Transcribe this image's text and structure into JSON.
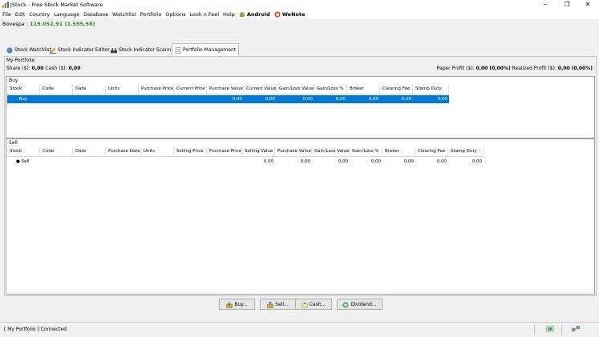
{
  "window": {
    "title": "JStock - Free Stock Market Software",
    "minimize": "–",
    "maximize": "❐",
    "close": "✕"
  },
  "menu": {
    "items": [
      "File",
      "Edit",
      "Country",
      "Language",
      "Database",
      "Watchlist",
      "Portfolio",
      "Options",
      "Look n Feel",
      "Help"
    ],
    "android": "Android",
    "wenote": "WeNote"
  },
  "market": {
    "label": "Bovespa :",
    "value": "119.052,91 (1.595,56)"
  },
  "tabs": [
    {
      "label": "Stock Watchlist",
      "icon": "globe-icon"
    },
    {
      "label": "Stock Indicator Editor",
      "icon": "pencil-icon"
    },
    {
      "label": "Stock Indicator Scanner",
      "icon": "binoculars-icon"
    },
    {
      "label": "Portfolio Management",
      "icon": "document-icon"
    }
  ],
  "portfolio": {
    "title": "My Portfolio",
    "share_label": "Share ($):",
    "share_value": "0,00",
    "cash_label": "Cash ($):",
    "cash_value": "0,00",
    "paper_profit_label": "Paper Profit ($):",
    "paper_profit_value": "0,00 (0,00%)",
    "realized_profit_label": "Realized Profit ($):",
    "realized_profit_value": "0,00 (0,00%)"
  },
  "buy_table": {
    "label": "Buy",
    "columns": [
      "Stock",
      "Code",
      "Date",
      "Units",
      "Purchase Price",
      "Current Price",
      "Purchase Value",
      "Current Value",
      "Gain/Loss Value",
      "Gain/Loss %",
      "Broker",
      "Clearing Fee",
      "Stamp Duty"
    ],
    "summary_row": {
      "stock": "Buy",
      "purchase_value": "0,00",
      "current_value": "0,00",
      "gain_loss_value": "0,00",
      "gain_loss_pct": "0,00",
      "broker": "0,00",
      "clearing_fee": "0,00",
      "stamp_duty": "0,00"
    }
  },
  "sell_table": {
    "label": "Sell",
    "columns": [
      "Stock",
      "Code",
      "Date",
      "Purchase Date",
      "Units",
      "Selling Price",
      "Purchase Price",
      "Selling Value",
      "Purchase Value",
      "Gain/Loss Value",
      "Gain/Loss %",
      "Broker",
      "Clearing Fee",
      "Stamp Duty"
    ],
    "summary_row": {
      "stock": "Sell",
      "selling_value": "0,00",
      "purchase_value": "0,00",
      "gain_loss_value": "0,00",
      "gain_loss_pct": "0,00",
      "broker": "0,00",
      "clearing_fee": "0,00",
      "stamp_duty": "0,00"
    }
  },
  "buttons": {
    "buy": "Buy...",
    "sell": "Sell...",
    "cash": "Cash...",
    "dividend": "Dividend..."
  },
  "status": {
    "text": "[ My Portfolio ] Connected"
  },
  "colors": {
    "selection": "#0078d7",
    "market_value": "#2e8b2e",
    "android": "#7cb342",
    "wenote": "#e64a19"
  }
}
